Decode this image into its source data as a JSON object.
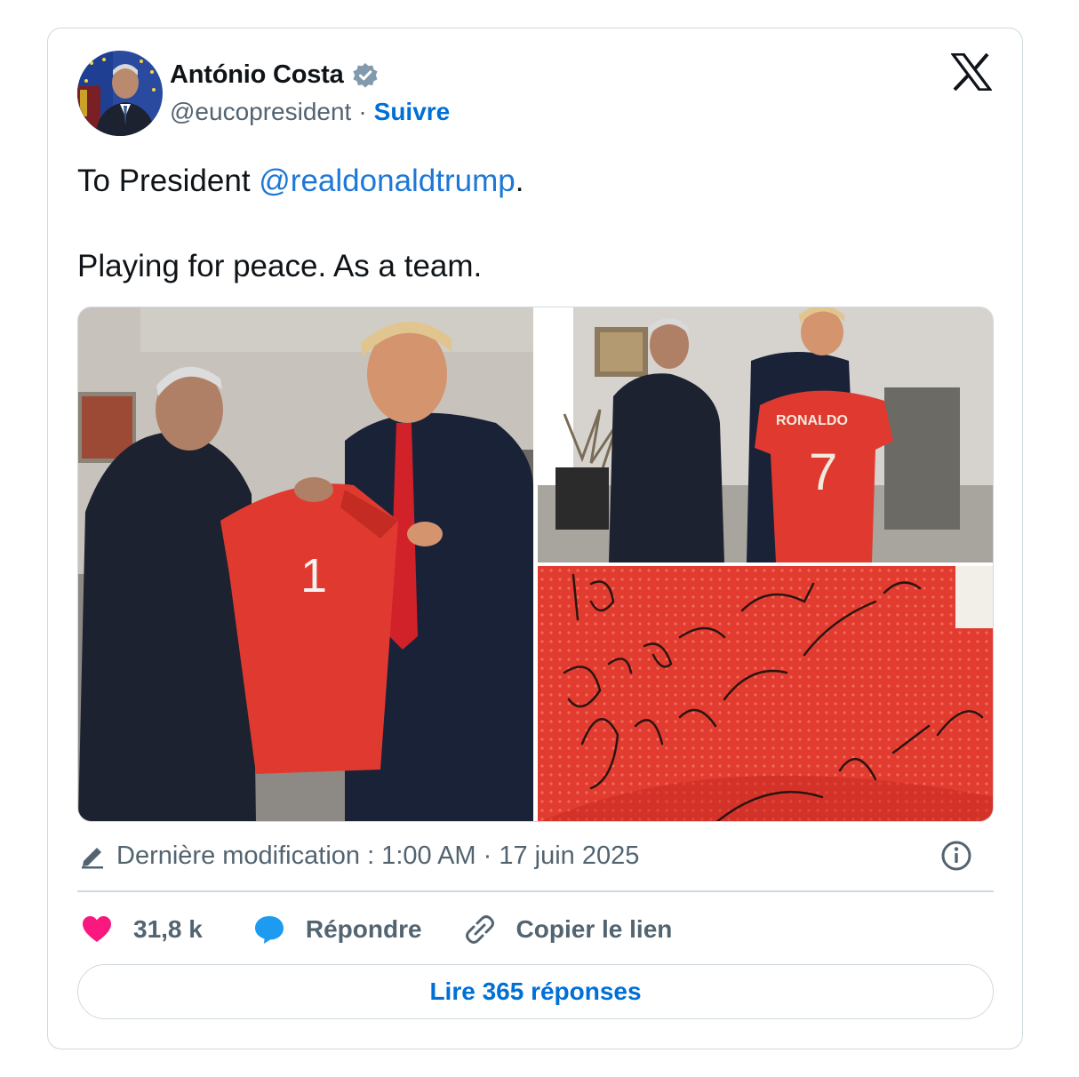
{
  "author": {
    "name": "António Costa",
    "handle": "@eucopresident",
    "separator": "·",
    "follow_label": "Suivre",
    "verified_icon": "verified-badge-icon",
    "avatar_icon": "avatar"
  },
  "platform_logo": "x-logo-icon",
  "tweet": {
    "prefix": "To President ",
    "mention": "@realdonaldtrump",
    "suffix": ".",
    "line2": "Playing for peace.  As a team."
  },
  "media": {
    "photos": [
      {
        "name": "photo-jersey-handover",
        "jersey_number": "1"
      },
      {
        "name": "photo-jersey-display",
        "jersey_name": "RONALDO",
        "jersey_number": "7"
      },
      {
        "name": "photo-signature-closeup",
        "handwriting": "Donald J. Trump · Playing for peace"
      }
    ]
  },
  "meta": {
    "edited_label": "Dernière modification : 1:00 AM · 17 juin 2025"
  },
  "actions": {
    "likes": "31,8 k",
    "reply_label": "Répondre",
    "copy_label": "Copier le lien"
  },
  "read_replies_label": "Lire 365 réponses",
  "colors": {
    "link": "#006fd6",
    "mention": "#1d78d6",
    "like": "#f91880",
    "reply": "#1d9bf0",
    "verified": "#829aab",
    "jersey_red": "#e03a30"
  }
}
